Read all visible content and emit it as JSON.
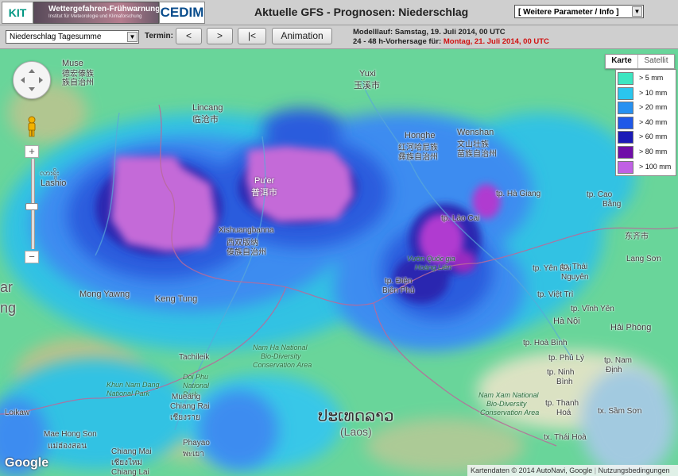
{
  "header": {
    "kit_logo_text": "KIT",
    "warning_title": "Wettergefahren-Frühwarnung",
    "warning_sub": "Institut für Meteorologie und Klimaforschung",
    "cedim_logo_text": "CEDIM",
    "title": "Aktuelle GFS - Prognosen: Niederschlag",
    "param_select": "[ Weitere Parameter / Info ]"
  },
  "toolbar": {
    "variable_select": "Niederschlag Tagesumme",
    "termin_label": "Termin:",
    "prev_label": "<",
    "next_label": ">",
    "first_label": "|<",
    "animation_label": "Animation",
    "model_run": "Modelllauf: Samstag, 19. Juli 2014, 00 UTC",
    "forecast_prefix": "24 - 48 h-Vorhersage für:",
    "forecast_date": "Montag, 21. Juli 2014, 00 UTC"
  },
  "map": {
    "map_type_karte": "Karte",
    "map_type_satellit": "Satellit",
    "zoom_in": "+",
    "zoom_out": "−",
    "google_logo": "Google",
    "attribution": "Kartendaten © 2014 AutoNavi, Google",
    "terms": "Nutzungsbedingungen",
    "labels": {
      "lashio": "Lashio",
      "lincang": "Lincang",
      "lincang_cn": "临沧市",
      "muse": "Muse",
      "dehong": "德宏傣族",
      "dehong2": "族自治州",
      "yuxi": "Yuxi",
      "yuxi_cn": "玉溪市",
      "puer": "Pu'er",
      "puer_cn": "普洱市",
      "honghe": "Honghe",
      "honghe_cn1": "红河哈尼族",
      "honghe_cn2": "彝族自治州",
      "wenshan": "Wenshan",
      "wenshan_cn1": "文山壮族",
      "wenshan_cn2": "苗族自治州",
      "xishuangbanna": "Xishuangbanna",
      "xishuangbanna_cn1": "西双版纳",
      "xishuangbanna_cn2": "傣族自治州",
      "ha_giang": "tp. Hà Giang",
      "lao_cai": "tp. Lào Cai",
      "cao_bang": "tp. Cao",
      "cao_bang2": "Bằng",
      "cao_bang_cn": "东齐市",
      "lang_son": "Lạng Sơn",
      "yen_bai": "tp. Yên Bái",
      "thai": "tp. Thái",
      "nguyen": "Nguyên",
      "viet_tri": "tp. Việt Trì",
      "vinh_yen": "tp. Vĩnh Yên",
      "ha_noi": "Hà Nội",
      "hai_phong": "Hải Phòng",
      "hoa_binh": "tp. Hoà Bình",
      "phu_ly": "tp. Phủ Lý",
      "nam_dinh1": "tp. Nam",
      "nam_dinh2": "Định",
      "ninh_binh1": "tp. Ninh",
      "ninh_binh2": "Bình",
      "thanh_hoa1": "tp. Thanh",
      "thanh_hoa2": "Hoá",
      "sam_son": "tx. Sầm Sơn",
      "thai_hoa": "tx. Thái Hoà",
      "dien_bien1": "tp. Điện",
      "dien_bien2": "Biên Phủ",
      "vuon_quoc_gia1": "Vườn Quốc gia",
      "vuon_quoc_gia2": "Hoàng Liên",
      "mong_yawng": "Mong Yawng",
      "keng_tung": "Keng Tung",
      "tachileik": "Tachileik",
      "nam_ha1": "Nam Ha National",
      "nam_ha2": "Bio-Diversity",
      "nam_ha3": "Conservation Area",
      "doi_phu1": "Doi Phu",
      "doi_phu2": "National",
      "doi_phu3": "Park",
      "nam_xam1": "Nam Xam National",
      "nam_xam2": "Bio-Diversity",
      "nam_xam3": "Conservation Area",
      "khun_nam1": "Khun Nam Dang",
      "khun_nam2": "National Park",
      "mae_hong_son": "Mae Hong Son",
      "mae_hong_son_th": "แม่ฮ่องสอน",
      "chiang_mai": "Chiang Mai",
      "chiang_mai_th": "เชียงใหม่",
      "chiang_rai": "Chiang Rai",
      "chiang_rai_th": "เชียงราย",
      "phayao": "Phayao",
      "phayao_th": "พะเยา",
      "mueang": "Mueang",
      "chiang_lai": "Chiang Lai",
      "loikaw": "Loikaw",
      "laos_native": "ປະເທດລາວ",
      "laos": "(Laos)",
      "ar": "ar",
      "lashio_my": "လားရှိုး",
      "myanmar_fragment": "ng"
    },
    "legend": [
      {
        "label": "> 5 mm",
        "color": "#3de6c1"
      },
      {
        "label": "> 10 mm",
        "color": "#2ac6ee"
      },
      {
        "label": "> 20 mm",
        "color": "#2691f1"
      },
      {
        "label": "> 40 mm",
        "color": "#1f58e8"
      },
      {
        "label": "> 60 mm",
        "color": "#1b1ab7"
      },
      {
        "label": "> 80 mm",
        "color": "#6f0ea8"
      },
      {
        "label": "> 100 mm",
        "color": "#c061e4"
      }
    ]
  }
}
